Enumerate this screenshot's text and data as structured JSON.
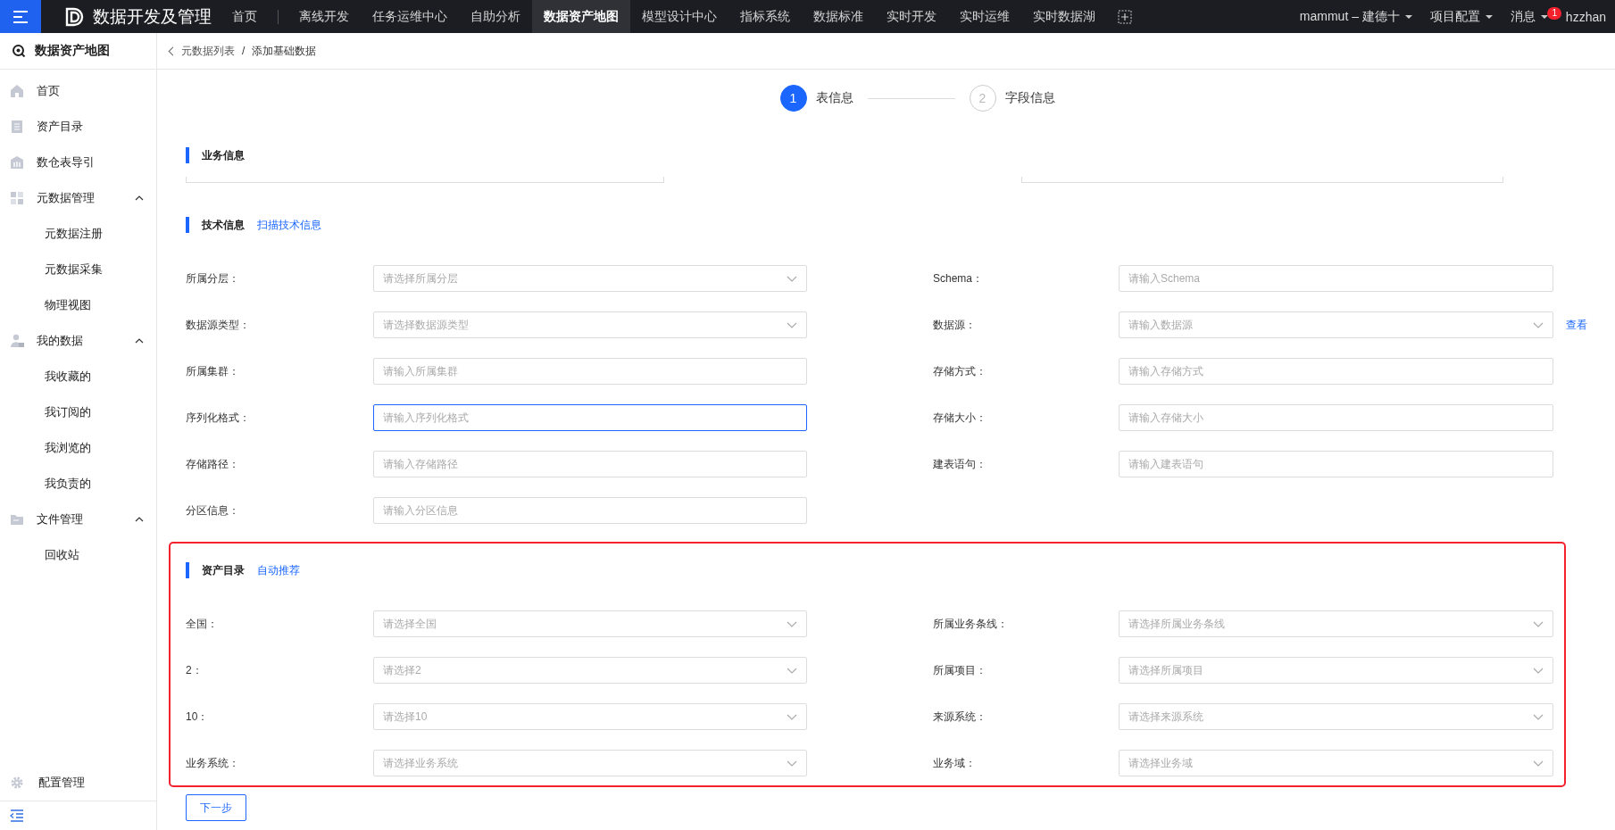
{
  "topbar": {
    "app_title": "数据开发及管理",
    "nav": [
      {
        "label": "首页",
        "selected": false
      },
      {
        "label": "离线开发",
        "selected": false
      },
      {
        "label": "任务运维中心",
        "selected": false
      },
      {
        "label": "自助分析",
        "selected": false
      },
      {
        "label": "数据资产地图",
        "selected": true
      },
      {
        "label": "模型设计中心",
        "selected": false
      },
      {
        "label": "指标系统",
        "selected": false
      },
      {
        "label": "数据标准",
        "selected": false
      },
      {
        "label": "实时开发",
        "selected": false
      },
      {
        "label": "实时运维",
        "selected": false
      },
      {
        "label": "实时数据湖",
        "selected": false
      }
    ],
    "right": [
      {
        "label": "mammut – 建德十",
        "dropdown": true
      },
      {
        "label": "项目配置",
        "dropdown": true
      },
      {
        "label": "消息",
        "dropdown": true,
        "badge": "1"
      },
      {
        "label": "hzzhan",
        "dropdown": false
      }
    ]
  },
  "sidebar": {
    "title": "数据资产地图",
    "items": [
      {
        "label": "首页",
        "kind": "home"
      },
      {
        "label": "资产目录",
        "kind": "list"
      },
      {
        "label": "数仓表导引",
        "kind": "bank"
      },
      {
        "label": "元数据管理",
        "kind": "grid",
        "expanded": true,
        "children": [
          {
            "label": "元数据注册"
          },
          {
            "label": "元数据采集"
          },
          {
            "label": "物理视图"
          }
        ]
      },
      {
        "label": "我的数据",
        "kind": "user",
        "expanded": true,
        "children": [
          {
            "label": "我收藏的"
          },
          {
            "label": "我订阅的"
          },
          {
            "label": "我浏览的"
          },
          {
            "label": "我负责的"
          }
        ]
      },
      {
        "label": "文件管理",
        "kind": "folder",
        "expanded": true,
        "children": [
          {
            "label": "回收站"
          }
        ]
      }
    ],
    "footer": "配置管理"
  },
  "breadcrumb": {
    "back": "元数据列表",
    "separator": "/",
    "current": "添加基础数据"
  },
  "steps": [
    {
      "number": "1",
      "label": "表信息",
      "selected": true
    },
    {
      "number": "2",
      "label": "字段信息",
      "selected": false
    }
  ],
  "sections": [
    {
      "title": "业务信息",
      "cut_off": true
    },
    {
      "title": "技术信息",
      "action": "扫描技术信息",
      "fields": [
        {
          "label": "所属分层：",
          "placeholder": "请选择所属分层",
          "kind": "select",
          "focused": false
        },
        {
          "label": "Schema：",
          "placeholder": "请输入Schema",
          "kind": "input",
          "focused": false
        },
        {
          "label": "数据源类型：",
          "placeholder": "请选择数据源类型",
          "kind": "select",
          "focused": false
        },
        {
          "label": "数据源：",
          "placeholder": "请输入数据源",
          "kind": "select",
          "focused": false,
          "link": "查看"
        },
        {
          "label": "所属集群：",
          "placeholder": "请输入所属集群",
          "kind": "input",
          "focused": false
        },
        {
          "label": "存储方式：",
          "placeholder": "请输入存储方式",
          "kind": "input",
          "focused": false
        },
        {
          "label": "序列化格式：",
          "placeholder": "请输入序列化格式",
          "kind": "input",
          "focused": true
        },
        {
          "label": "存储大小：",
          "placeholder": "请输入存储大小",
          "kind": "input",
          "focused": false
        },
        {
          "label": "存储路径：",
          "placeholder": "请输入存储路径",
          "kind": "input",
          "focused": false
        },
        {
          "label": "建表语句：",
          "placeholder": "请输入建表语句",
          "kind": "input",
          "focused": false
        },
        {
          "label": "分区信息：",
          "placeholder": "请输入分区信息",
          "kind": "input",
          "focused": false
        }
      ]
    },
    {
      "title": "资产目录",
      "action": "自动推荐",
      "highlighted": true,
      "fields": [
        {
          "label": "全国：",
          "placeholder": "请选择全国",
          "kind": "select",
          "focused": false
        },
        {
          "label": "所属业务条线：",
          "placeholder": "请选择所属业务条线",
          "kind": "select",
          "focused": false
        },
        {
          "label": "2：",
          "placeholder": "请选择2",
          "kind": "select",
          "focused": false
        },
        {
          "label": "所属项目：",
          "placeholder": "请选择所属项目",
          "kind": "select",
          "focused": false
        },
        {
          "label": "10：",
          "placeholder": "请选择10",
          "kind": "select",
          "focused": false
        },
        {
          "label": "来源系统：",
          "placeholder": "请选择来源系统",
          "kind": "select",
          "focused": false
        },
        {
          "label": "业务系统：",
          "placeholder": "请选择业务系统",
          "kind": "select",
          "focused": false
        },
        {
          "label": "业务域：",
          "placeholder": "请选择业务域",
          "kind": "select",
          "focused": false
        }
      ]
    }
  ],
  "next_button": "下一步"
}
